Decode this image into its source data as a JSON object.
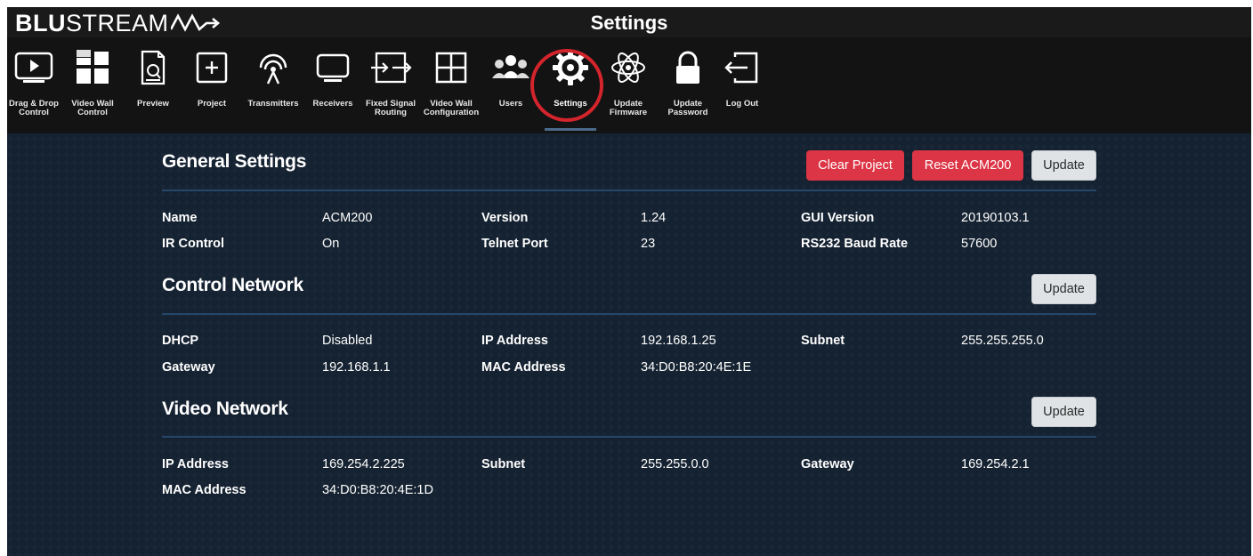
{
  "brand": {
    "bold": "BLU",
    "rest": "STREAM"
  },
  "page_title": "Settings",
  "nav": [
    {
      "label": "Drag & Drop\nControl",
      "icon": "drag-drop-control-icon"
    },
    {
      "label": "Video Wall\nControl",
      "icon": "video-wall-control-icon"
    },
    {
      "label": "Preview",
      "icon": "preview-icon"
    },
    {
      "label": "Project",
      "icon": "project-icon"
    },
    {
      "label": "Transmitters",
      "icon": "transmitters-icon"
    },
    {
      "label": "Receivers",
      "icon": "receivers-icon"
    },
    {
      "label": "Fixed Signal\nRouting",
      "icon": "fixed-signal-routing-icon"
    },
    {
      "label": "Video Wall\nConfiguration",
      "icon": "video-wall-configuration-icon"
    },
    {
      "label": "Users",
      "icon": "users-icon"
    },
    {
      "label": "Settings",
      "icon": "gear-icon",
      "active": true
    },
    {
      "label": "Update\nFirmware",
      "icon": "update-firmware-icon"
    },
    {
      "label": "Update\nPassword",
      "icon": "lock-icon"
    },
    {
      "label": "Log Out",
      "icon": "log-out-icon"
    }
  ],
  "general": {
    "title": "General Settings",
    "buttons": {
      "clear": "Clear Project",
      "reset": "Reset ACM200",
      "update": "Update"
    },
    "fields": {
      "name_label": "Name",
      "name_value": "ACM200",
      "version_label": "Version",
      "version_value": "1.24",
      "gui_label": "GUI Version",
      "gui_value": "20190103.1",
      "ir_label": "IR Control",
      "ir_value": "On",
      "telnet_label": "Telnet Port",
      "telnet_value": "23",
      "baud_label": "RS232 Baud Rate",
      "baud_value": "57600"
    }
  },
  "control_network": {
    "title": "Control Network",
    "update": "Update",
    "fields": {
      "dhcp_label": "DHCP",
      "dhcp_value": "Disabled",
      "ip_label": "IP Address",
      "ip_value": "192.168.1.25",
      "subnet_label": "Subnet",
      "subnet_value": "255.255.255.0",
      "gateway_label": "Gateway",
      "gateway_value": "192.168.1.1",
      "mac_label": "MAC Address",
      "mac_value": "34:D0:B8:20:4E:1E"
    }
  },
  "video_network": {
    "title": "Video Network",
    "update": "Update",
    "fields": {
      "ip_label": "IP Address",
      "ip_value": "169.254.2.225",
      "subnet_label": "Subnet",
      "subnet_value": "255.255.0.0",
      "gateway_label": "Gateway",
      "gateway_value": "169.254.2.1",
      "mac_label": "MAC Address",
      "mac_value": "34:D0:B8:20:4E:1D"
    }
  },
  "colors": {
    "accent_red": "#dc3545",
    "ring_red": "#d4242c",
    "background": "#152231",
    "rule": "#24476b"
  }
}
